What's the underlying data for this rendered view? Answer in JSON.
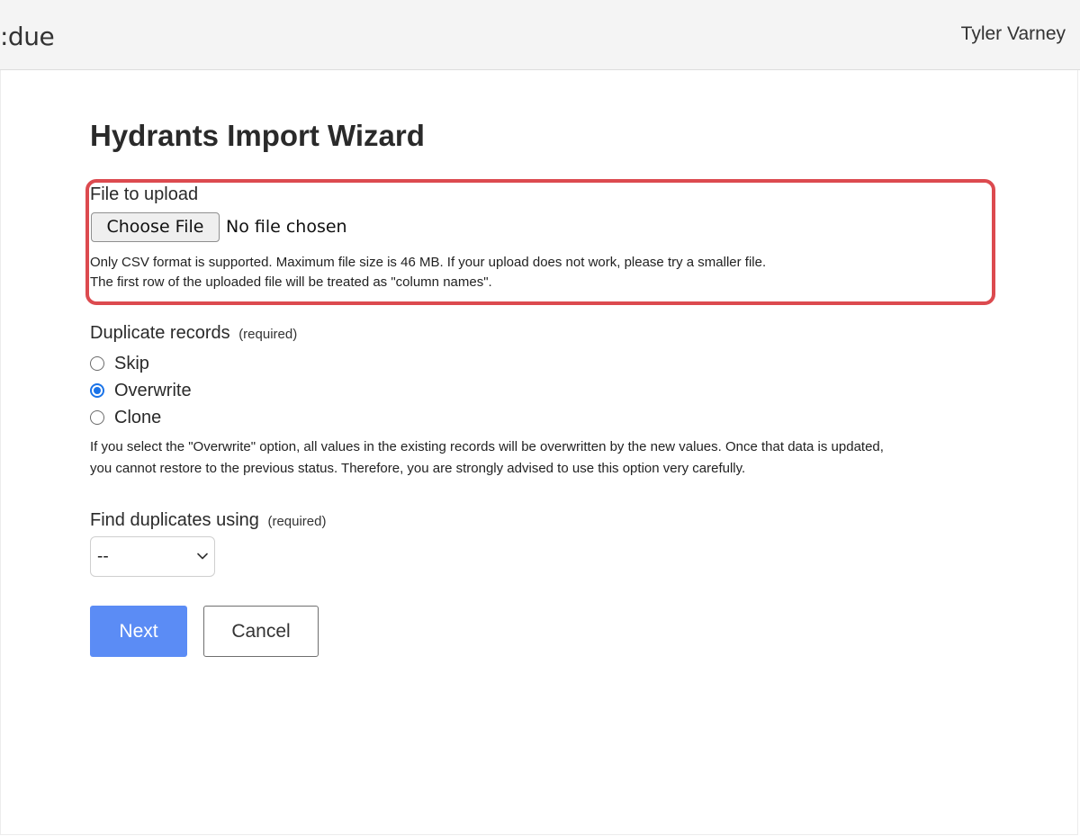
{
  "header": {
    "logo_text": ":due",
    "user_name": "Tyler Varney"
  },
  "page": {
    "title": "Hydrants Import Wizard"
  },
  "file_upload": {
    "label": "File to upload",
    "button_label": "Choose File",
    "status_text": "No file chosen",
    "help_lines": [
      "Only CSV format is supported. Maximum file size is 46 MB. If your upload does not work, please try a smaller file.",
      "The first row of the uploaded file will be treated as \"column names\"."
    ],
    "highlight_color": "#dc4a4f"
  },
  "duplicate_records": {
    "label": "Duplicate records",
    "required_text": "(required)",
    "options": [
      {
        "label": "Skip",
        "checked": false
      },
      {
        "label": "Overwrite",
        "checked": true
      },
      {
        "label": "Clone",
        "checked": false
      }
    ],
    "warning_lines": [
      "If you select the \"Overwrite\" option, all values in the existing records will be overwritten by the new values. Once that data is updated,",
      "you cannot restore to the previous status. Therefore, you are strongly advised to use this option very carefully."
    ]
  },
  "find_duplicates": {
    "label": "Find duplicates using",
    "required_text": "(required)",
    "selected_value": "--",
    "icon": "chevron-down-icon"
  },
  "actions": {
    "next_label": "Next",
    "cancel_label": "Cancel",
    "next_color": "#5b8cf5"
  },
  "colors": {
    "radio_checked": "#1a73e8",
    "topbar_bg": "#f4f4f4"
  }
}
